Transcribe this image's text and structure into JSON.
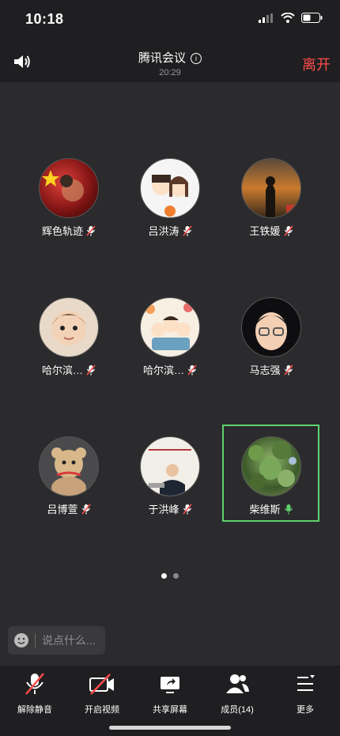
{
  "status": {
    "time": "10:18"
  },
  "meeting": {
    "title": "腾讯会议",
    "duration": "20:29",
    "leave_label": "离开"
  },
  "participants": [
    {
      "name": "辉色轨迹",
      "mic": "muted",
      "avatar": "avatar-photo"
    },
    {
      "name": "吕洪涛",
      "mic": "muted",
      "avatar": "avatar-cartoon-couple"
    },
    {
      "name": "王铁媛",
      "mic": "muted",
      "avatar": "avatar-sunset"
    },
    {
      "name": "哈尔滨…",
      "mic": "muted",
      "avatar": "avatar-baby"
    },
    {
      "name": "哈尔滨…",
      "mic": "muted",
      "avatar": "avatar-cartoon-family"
    },
    {
      "name": "马志强",
      "mic": "muted",
      "avatar": "avatar-memoji"
    },
    {
      "name": "吕博萱",
      "mic": "muted",
      "avatar": "avatar-teddy"
    },
    {
      "name": "于洪峰",
      "mic": "muted",
      "avatar": "avatar-man"
    },
    {
      "name": "柴维斯",
      "mic": "active",
      "avatar": "avatar-tree"
    }
  ],
  "chat": {
    "placeholder": "说点什么..."
  },
  "toolbar": {
    "unmute": "解除静音",
    "video": "开启视频",
    "share": "共享屏幕",
    "members": "成员(14)",
    "more": "更多"
  },
  "colors": {
    "accent_leave": "#ff4b4b",
    "active_speaker": "#5ed26e"
  }
}
